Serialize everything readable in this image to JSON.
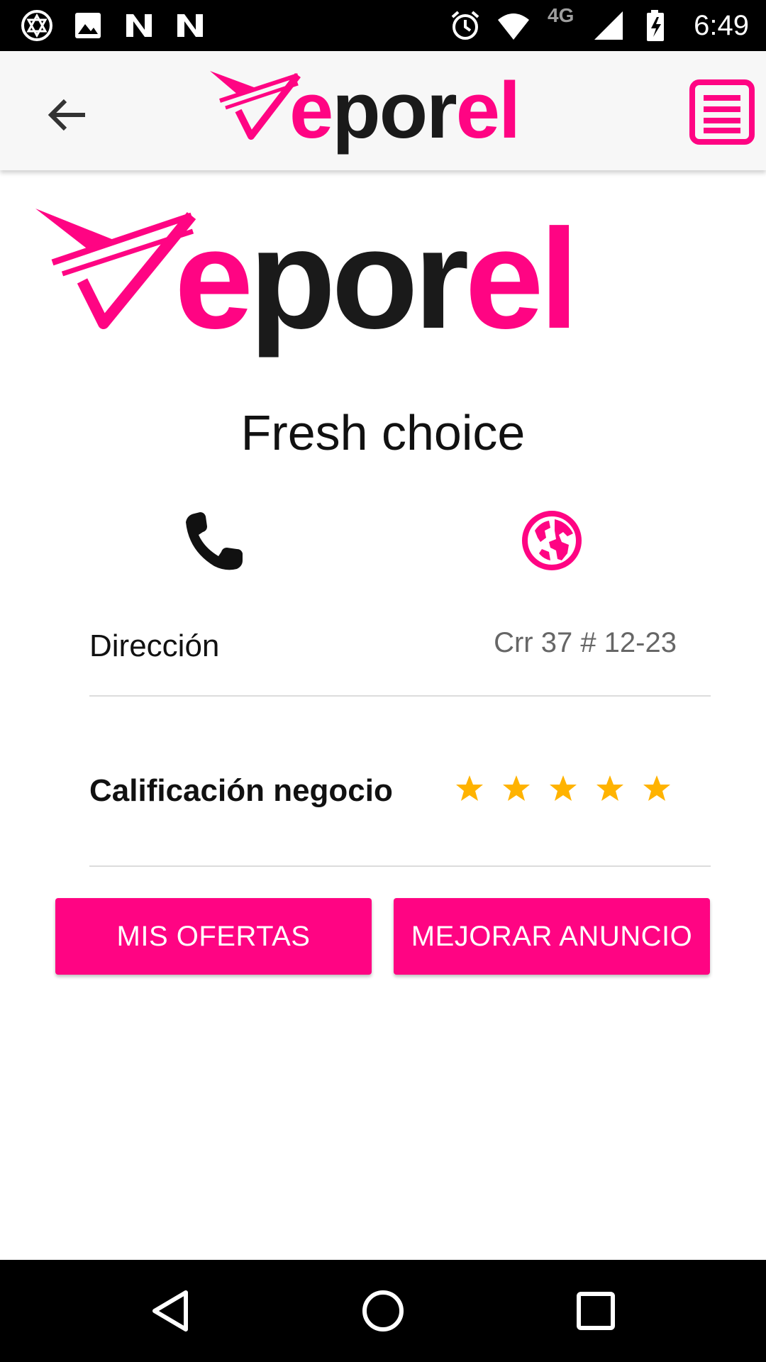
{
  "status_bar": {
    "time": "6:49",
    "network": "4G",
    "left_icons": [
      "app-icon",
      "image-icon",
      "n-icon",
      "n-icon"
    ],
    "right_icons": [
      "alarm-icon",
      "wifi-icon",
      "signal-icon",
      "battery-icon"
    ]
  },
  "app_bar": {
    "logo": "eporel",
    "back_icon": "arrow-back-icon",
    "menu_icon": "menu-icon"
  },
  "brand": {
    "name": "eporel",
    "accent": "#ff0483",
    "dark": "#1a1a1a"
  },
  "business": {
    "name": "Fresh choice",
    "address_label": "Dirección",
    "address_value": "Crr 37 # 12-23",
    "rating_label": "Calificación negocio",
    "rating_stars": 5
  },
  "actions": {
    "offers": "MIS OFERTAS",
    "improve": "MEJORAR ANUNCIO"
  },
  "colors": {
    "accent": "#ff0483",
    "star": "#ffb300",
    "text": "#111111",
    "muted": "#666666"
  }
}
